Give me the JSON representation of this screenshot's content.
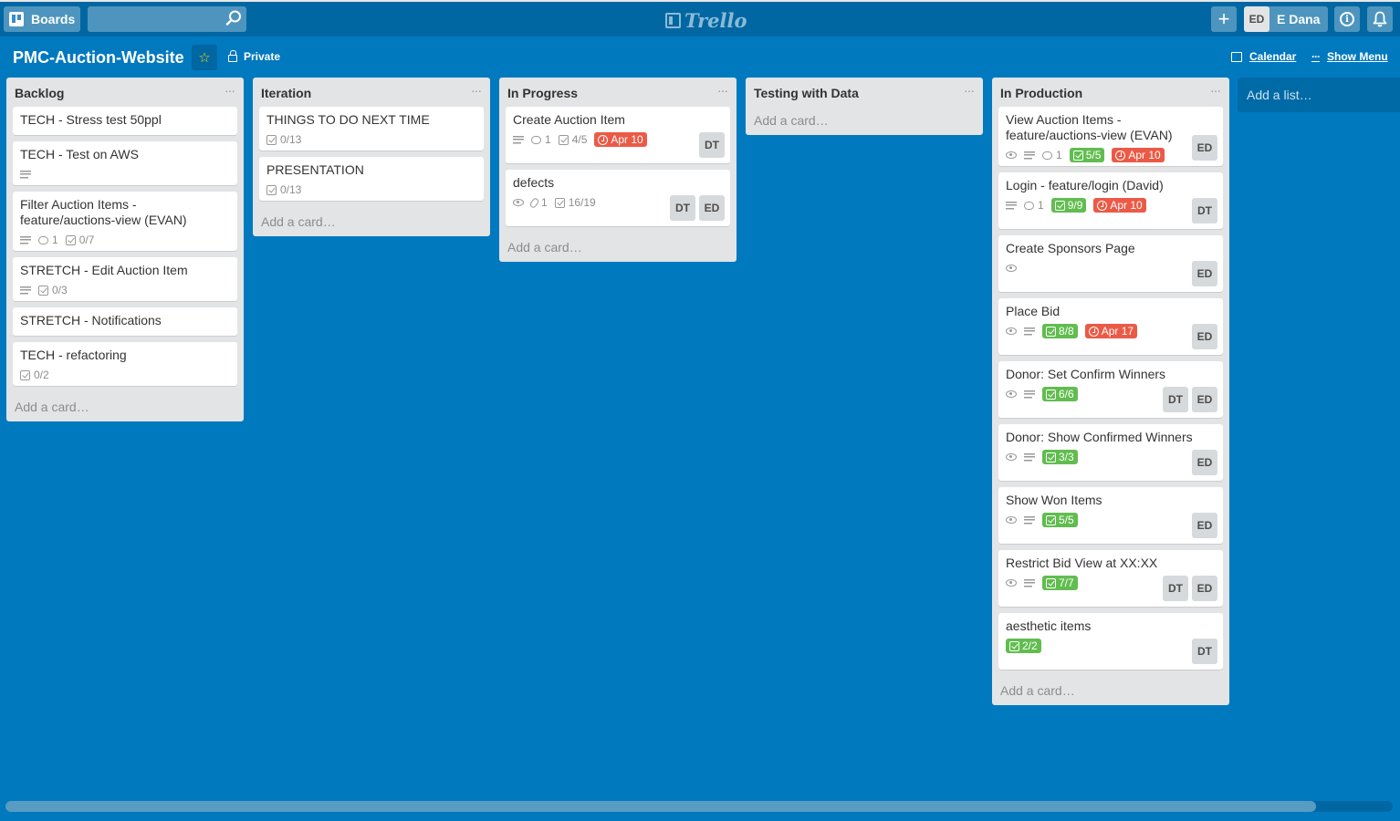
{
  "topbar": {
    "boards_label": "Boards",
    "search_placeholder": "",
    "logo_text": "Trello",
    "add_symbol": "+",
    "user_initials": "ED",
    "user_name": "E Dana",
    "info_symbol": "i"
  },
  "board": {
    "title": "PMC-Auction-Website",
    "star_symbol": "☆",
    "privacy": "Private",
    "calendar_label": "Calendar",
    "show_menu_label": "Show Menu",
    "add_list_label": "Add a list…"
  },
  "icons": {
    "description": "description-icon",
    "comment": "comment-icon",
    "checklist": "checklist-icon",
    "due": "clock-icon",
    "watch": "eye-icon",
    "attachment": "paperclip-icon"
  },
  "colors": {
    "background": "#0079bf",
    "topbar": "#0067a3",
    "list": "#e2e4e6",
    "green_badge": "#61bd4f",
    "red_badge": "#eb5a46",
    "star": "#f2d600"
  },
  "lists": [
    {
      "title": "Backlog",
      "menu": "···",
      "add_card": "Add a card…",
      "cards": [
        {
          "title": "TECH - Stress test 50ppl",
          "badges": [],
          "members": []
        },
        {
          "title": "TECH - Test on AWS",
          "badges": [
            {
              "kind": "description"
            }
          ],
          "members": []
        },
        {
          "title": "Filter Auction Items - feature/auctions-view (EVAN)",
          "badges": [
            {
              "kind": "description"
            },
            {
              "kind": "comment",
              "text": "1"
            },
            {
              "kind": "checklist",
              "text": "0/7"
            }
          ],
          "members": []
        },
        {
          "title": "STRETCH - Edit Auction Item",
          "badges": [
            {
              "kind": "description"
            },
            {
              "kind": "checklist",
              "text": "0/3"
            }
          ],
          "members": []
        },
        {
          "title": "STRETCH - Notifications",
          "badges": [],
          "members": []
        },
        {
          "title": "TECH - refactoring",
          "badges": [
            {
              "kind": "checklist",
              "text": "0/2"
            }
          ],
          "members": []
        }
      ]
    },
    {
      "title": "Iteration",
      "menu": "···",
      "add_card": "Add a card…",
      "cards": [
        {
          "title": "THINGS TO DO NEXT TIME",
          "badges": [
            {
              "kind": "checklist",
              "text": "0/13"
            }
          ],
          "members": []
        },
        {
          "title": "PRESENTATION",
          "badges": [
            {
              "kind": "checklist",
              "text": "0/13"
            }
          ],
          "members": []
        }
      ]
    },
    {
      "title": "In Progress",
      "menu": "···",
      "add_card": "Add a card…",
      "cards": [
        {
          "title": "Create Auction Item",
          "badges": [
            {
              "kind": "description"
            },
            {
              "kind": "comment",
              "text": "1"
            },
            {
              "kind": "checklist",
              "text": "4/5"
            },
            {
              "kind": "due",
              "text": "Apr 10",
              "color": "red"
            }
          ],
          "members": [
            "DT"
          ]
        },
        {
          "title": "defects",
          "badges": [
            {
              "kind": "watch"
            },
            {
              "kind": "attachment",
              "text": "1"
            },
            {
              "kind": "checklist",
              "text": "16/19"
            }
          ],
          "members": [
            "DT",
            "ED"
          ]
        }
      ]
    },
    {
      "title": "Testing with Data",
      "menu": "···",
      "add_card": "Add a card…",
      "cards": []
    },
    {
      "title": "In Production",
      "menu": "···",
      "add_card": "Add a card…",
      "cards": [
        {
          "title": "View Auction Items - feature/auctions-view (EVAN)",
          "badges": [
            {
              "kind": "watch"
            },
            {
              "kind": "description"
            },
            {
              "kind": "comment",
              "text": "1"
            },
            {
              "kind": "checklist",
              "text": "5/5",
              "color": "green"
            },
            {
              "kind": "due",
              "text": "Apr 10",
              "color": "red"
            }
          ],
          "members": [
            "ED"
          ]
        },
        {
          "title": "Login - feature/login (David)",
          "badges": [
            {
              "kind": "description"
            },
            {
              "kind": "comment",
              "text": "1"
            },
            {
              "kind": "checklist",
              "text": "9/9",
              "color": "green"
            },
            {
              "kind": "due",
              "text": "Apr 10",
              "color": "red"
            }
          ],
          "members": [
            "DT"
          ]
        },
        {
          "title": "Create Sponsors Page",
          "badges": [
            {
              "kind": "watch"
            }
          ],
          "members": [
            "ED"
          ]
        },
        {
          "title": "Place Bid",
          "badges": [
            {
              "kind": "watch"
            },
            {
              "kind": "description"
            },
            {
              "kind": "checklist",
              "text": "8/8",
              "color": "green"
            },
            {
              "kind": "due",
              "text": "Apr 17",
              "color": "red"
            }
          ],
          "members": [
            "ED"
          ]
        },
        {
          "title": "Donor: Set Confirm Winners",
          "badges": [
            {
              "kind": "watch"
            },
            {
              "kind": "description"
            },
            {
              "kind": "checklist",
              "text": "6/6",
              "color": "green"
            }
          ],
          "members": [
            "DT",
            "ED"
          ]
        },
        {
          "title": "Donor: Show Confirmed Winners",
          "badges": [
            {
              "kind": "watch"
            },
            {
              "kind": "description"
            },
            {
              "kind": "checklist",
              "text": "3/3",
              "color": "green"
            }
          ],
          "members": [
            "ED"
          ]
        },
        {
          "title": "Show Won Items",
          "badges": [
            {
              "kind": "watch"
            },
            {
              "kind": "description"
            },
            {
              "kind": "checklist",
              "text": "5/5",
              "color": "green"
            }
          ],
          "members": [
            "ED"
          ]
        },
        {
          "title": "Restrict Bid View at XX:XX",
          "badges": [
            {
              "kind": "watch"
            },
            {
              "kind": "description"
            },
            {
              "kind": "checklist",
              "text": "7/7",
              "color": "green"
            }
          ],
          "members": [
            "DT",
            "ED"
          ]
        },
        {
          "title": "aesthetic items",
          "badges": [
            {
              "kind": "checklist",
              "text": "2/2",
              "color": "green"
            }
          ],
          "members": [
            "DT"
          ]
        }
      ]
    }
  ]
}
